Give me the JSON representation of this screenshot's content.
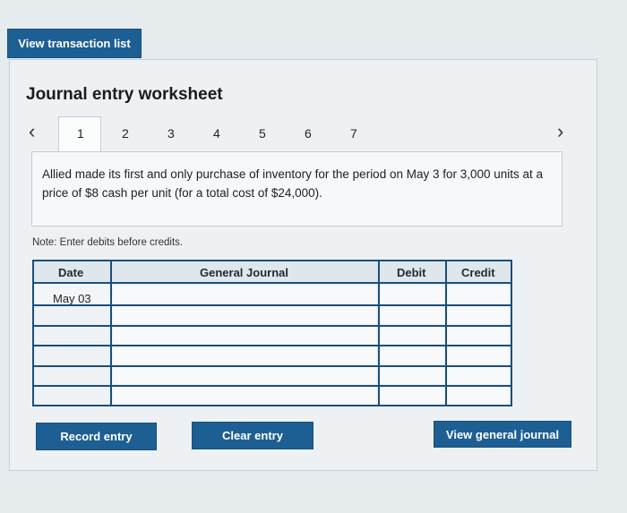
{
  "header": {
    "view_transaction_list": "View transaction list"
  },
  "worksheet": {
    "title": "Journal entry worksheet",
    "tabs": [
      "1",
      "2",
      "3",
      "4",
      "5",
      "6",
      "7"
    ],
    "active_tab": "1",
    "prev_icon": "‹",
    "next_icon": "›",
    "description": "Allied made its first and only purchase of inventory for the period on May 3 for 3,000 units at a price of $8 cash per unit (for a total cost of $24,000).",
    "note": "Note: Enter debits before credits."
  },
  "journal": {
    "headers": {
      "date": "Date",
      "general_journal": "General Journal",
      "debit": "Debit",
      "credit": "Credit"
    },
    "rows": [
      {
        "date": "May 03",
        "account": "",
        "debit": "",
        "credit": ""
      },
      {
        "date": "",
        "account": "",
        "debit": "",
        "credit": ""
      },
      {
        "date": "",
        "account": "",
        "debit": "",
        "credit": ""
      },
      {
        "date": "",
        "account": "",
        "debit": "",
        "credit": ""
      },
      {
        "date": "",
        "account": "",
        "debit": "",
        "credit": ""
      },
      {
        "date": "",
        "account": "",
        "debit": "",
        "credit": ""
      }
    ]
  },
  "actions": {
    "record_entry": "Record entry",
    "clear_entry": "Clear entry",
    "view_general_journal": "View general journal"
  },
  "colors": {
    "button": "#1d5f93",
    "table_border": "#1a4f7a"
  }
}
